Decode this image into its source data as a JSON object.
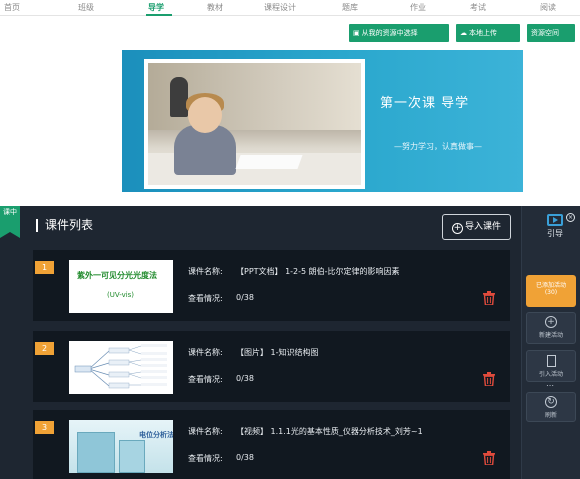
{
  "nav": {
    "items": [
      "首页",
      "班级",
      "导学",
      "教材",
      "课程设计",
      "题库",
      "作业",
      "考试",
      "阅读"
    ],
    "active": "导学"
  },
  "actions": {
    "btn1": "从我的资源中选择",
    "btn2": "本地上传",
    "btn3": "资源空间"
  },
  "banner": {
    "title": "第一次课 导学",
    "subtitle": "—努力学习，认真做事—"
  },
  "panel": {
    "corner_tag": "课中",
    "list_title": "课件列表",
    "import_label": "导入课件",
    "cards": [
      {
        "num": "1",
        "name_label": "课件名称:",
        "name_value": "【PPT文档】 1-2-5 朗伯-比尔定律的影响因素",
        "view_label": "查看情况:",
        "view_value": "0/38",
        "thumb_title": "紫外一可见分光光度法",
        "thumb_sub": "(UV-vis)"
      },
      {
        "num": "2",
        "name_label": "课件名称:",
        "name_value": "【图片】 1-知识结构图",
        "view_label": "查看情况:",
        "view_value": "0/38"
      },
      {
        "num": "3",
        "name_label": "课件名称:",
        "name_value": "【视频】 1.1.1光的基本性质_仪器分析技术_刘芳~1",
        "view_label": "查看情况:",
        "view_value": "0/38",
        "thumb_title": "电位分析法"
      }
    ]
  },
  "sidebar": {
    "guide_label": "引导",
    "added_label": "已添加活动",
    "added_count": "(30)",
    "new_label": "新建活动",
    "import_label": "引入活动",
    "refresh_label": "刷新"
  },
  "colors": {
    "accent": "#1a9e6e",
    "orange": "#f0a236",
    "panel_bg": "#1e2631",
    "trash": "#e04b3c"
  }
}
